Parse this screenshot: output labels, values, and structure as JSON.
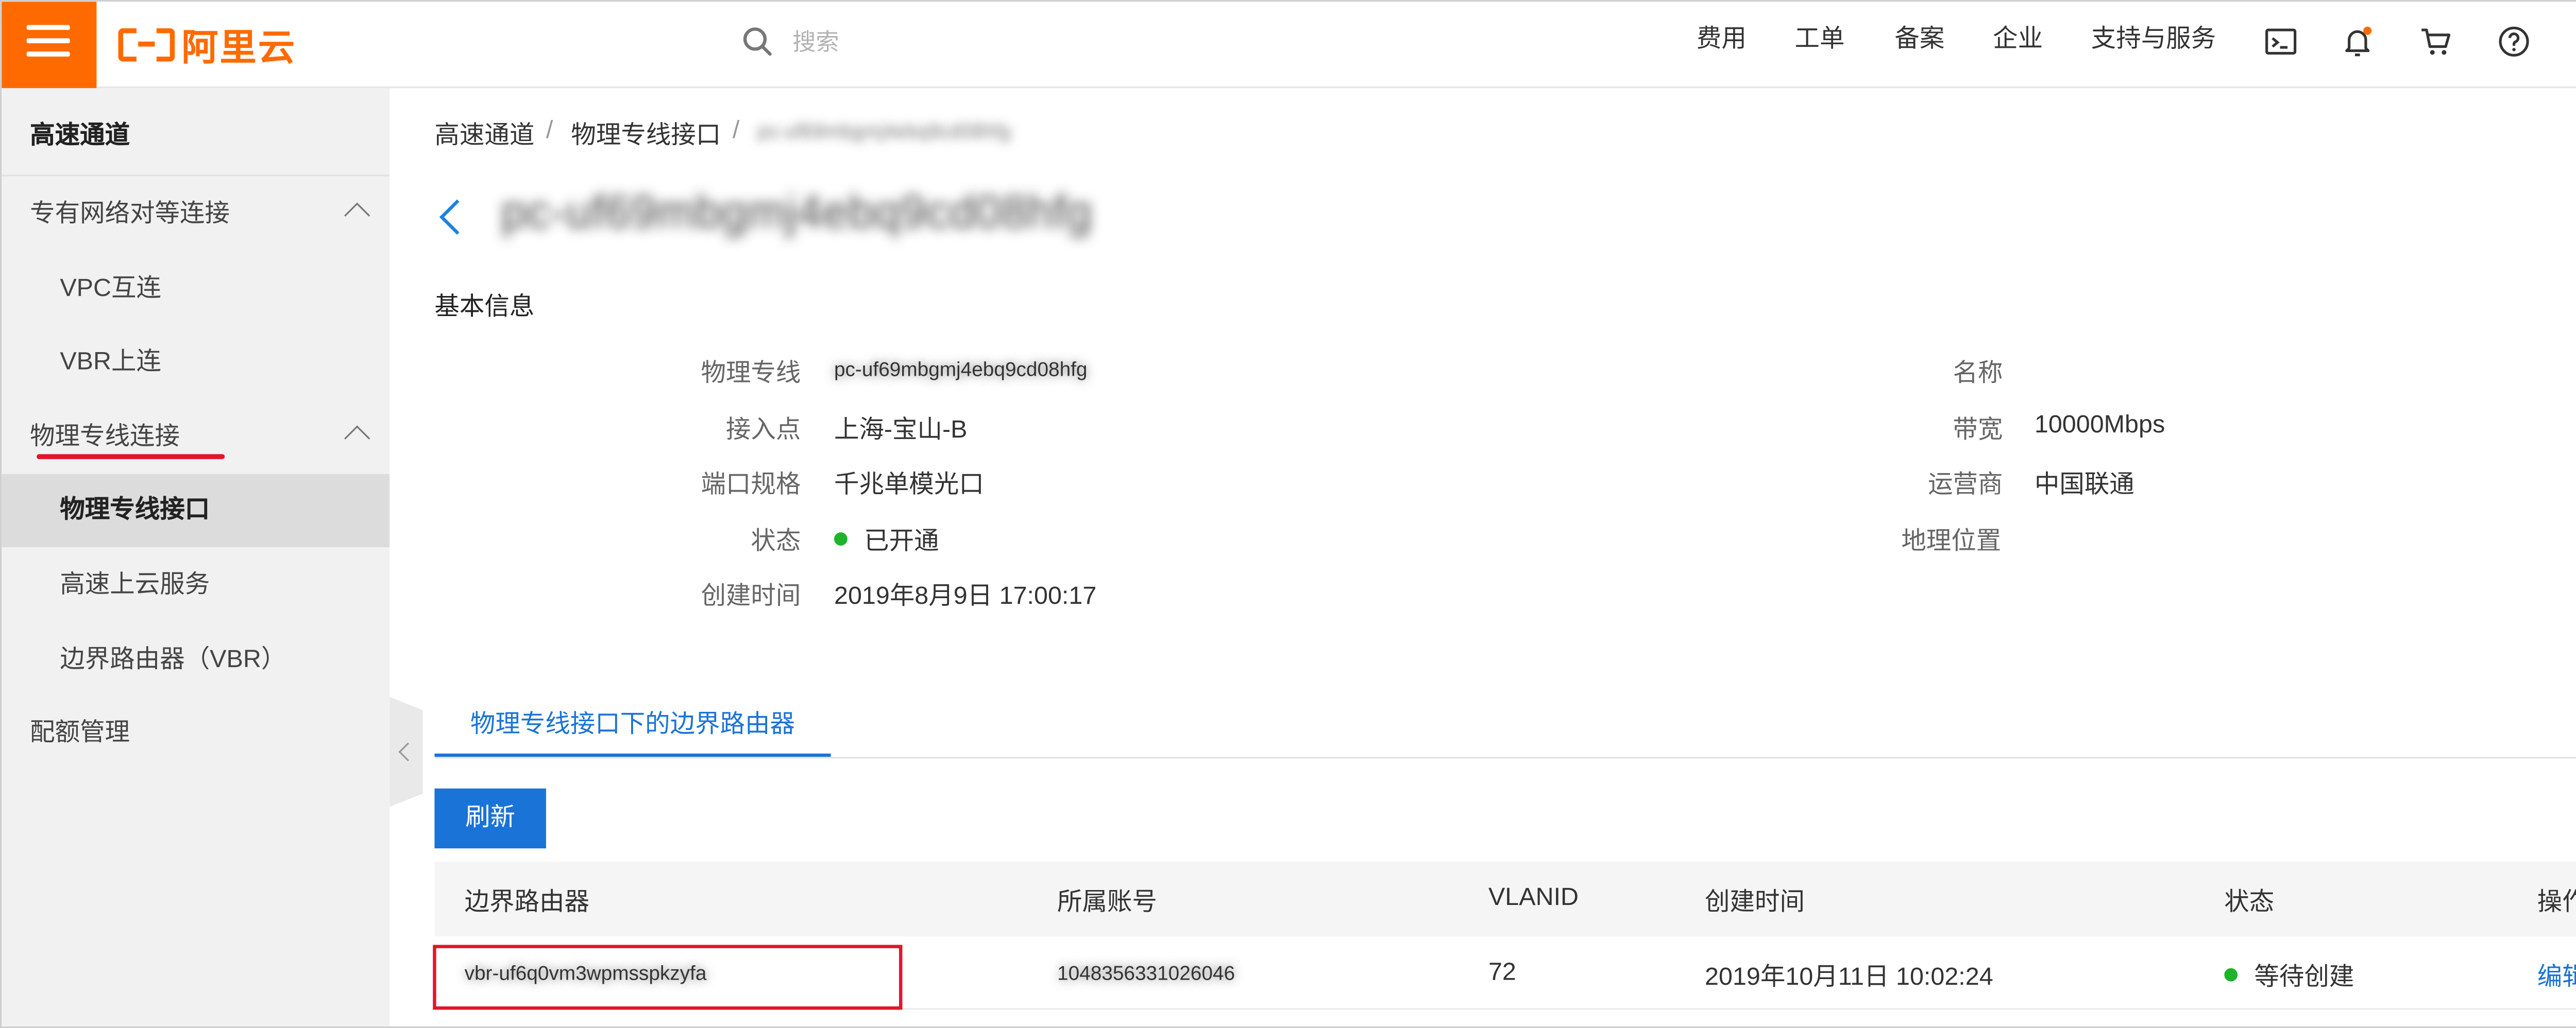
{
  "brand": {
    "logo_text": "阿里云",
    "accent": "#ff6a00",
    "link": "#1a73d6",
    "alert": "#e4142a"
  },
  "header": {
    "search_placeholder": "搜索",
    "nav": [
      "费用",
      "工单",
      "备案",
      "企业",
      "支持与服务"
    ],
    "icons": [
      "terminal-icon",
      "bell-icon",
      "cart-icon",
      "help-icon",
      "home-icon"
    ]
  },
  "sidebar": {
    "title": "高速通道",
    "groups": [
      {
        "label": "专有网络对等连接",
        "expanded": true,
        "items": [
          "VPC互连",
          "VBR上连"
        ]
      },
      {
        "label": "物理专线连接",
        "expanded": true,
        "items": [
          "物理专线接口",
          "高速上云服务",
          "边界路由器（VBR）"
        ]
      }
    ],
    "quota": "配额管理",
    "active_item": "物理专线接口"
  },
  "breadcrumb": [
    "高速通道",
    "物理专线接口",
    "pc-uf69mbgmj4ebq9cd08hfg"
  ],
  "page_title": "pc-uf69mbgmj4ebq9cd08hfg",
  "basic_info": {
    "title": "基本信息",
    "left": [
      {
        "label": "物理专线",
        "value": "pc-uf69mbgmj4ebq9cd08hfg",
        "blurred": true
      },
      {
        "label": "接入点",
        "value": "上海-宝山-B"
      },
      {
        "label": "端口规格",
        "value": "千兆单模光口"
      },
      {
        "label": "状态",
        "value": "已开通",
        "status_color": "#1fb32b"
      },
      {
        "label": "创建时间",
        "value": "2019年8月9日 17:00:17"
      }
    ],
    "right": [
      {
        "label": "名称",
        "value": ""
      },
      {
        "label": "带宽",
        "value": "10000Mbps"
      },
      {
        "label": "运营商",
        "value": "中国联通"
      },
      {
        "label": "地理位置",
        "value": ""
      }
    ]
  },
  "tab": {
    "label": "物理专线接口下的边界路由器"
  },
  "refresh_label": "刷新",
  "table": {
    "headers": [
      "边界路由器",
      "所属账号",
      "VLANID",
      "创建时间",
      "状态",
      "操作"
    ],
    "rows": [
      {
        "vbr": "vbr-uf6q0vm3wpmsspkzyfa",
        "account": "1048356331026046",
        "vlanid": "72",
        "created": "2019年10月11日 10:02:24",
        "status": "等待创建",
        "status_color": "#1fb32b",
        "action": "编辑"
      }
    ]
  }
}
